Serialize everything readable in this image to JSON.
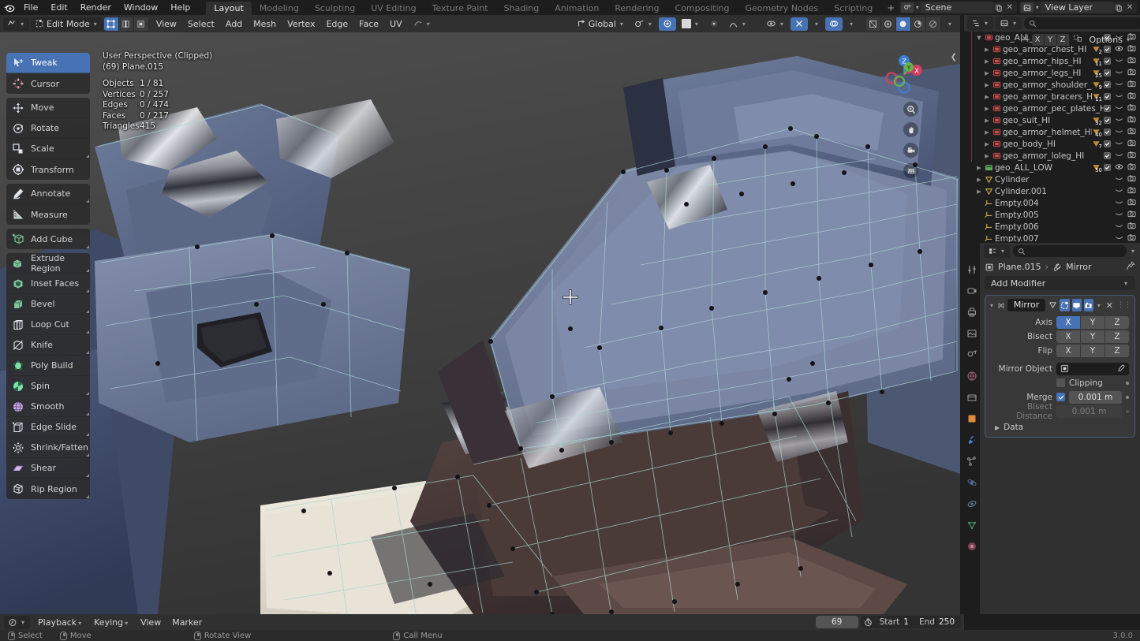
{
  "topbar": {
    "menus": [
      "File",
      "Edit",
      "Render",
      "Window",
      "Help"
    ],
    "workspaces": [
      {
        "label": "Layout",
        "active": true
      },
      {
        "label": "Modeling",
        "active": false
      },
      {
        "label": "Sculpting",
        "active": false
      },
      {
        "label": "UV Editing",
        "active": false
      },
      {
        "label": "Texture Paint",
        "active": false
      },
      {
        "label": "Shading",
        "active": false
      },
      {
        "label": "Animation",
        "active": false
      },
      {
        "label": "Rendering",
        "active": false
      },
      {
        "label": "Compositing",
        "active": false
      },
      {
        "label": "Geometry Nodes",
        "active": false
      },
      {
        "label": "Scripting",
        "active": false
      }
    ],
    "add_workspace": "+",
    "scene_name": "Scene",
    "view_layer_name": "View Layer"
  },
  "viewport_header": {
    "mode": "Edit Mode",
    "menus": [
      "View",
      "Select",
      "Add",
      "Mesh",
      "Vertex",
      "Edge",
      "Face",
      "UV"
    ],
    "transform_orientation": "Global",
    "select_modes": [
      "vertex-select",
      "edge-select",
      "face-select"
    ],
    "options_label": "Options",
    "mirror_axes": [
      "X",
      "Y",
      "Z"
    ]
  },
  "toolbar": {
    "groups": [
      [
        {
          "label": "Tweak",
          "icon": "tweak-icon",
          "active": true,
          "tip": false
        },
        {
          "label": "Cursor",
          "icon": "cursor-icon",
          "active": false,
          "tip": false
        }
      ],
      [
        {
          "label": "Move",
          "icon": "move-icon",
          "active": false,
          "tip": false
        },
        {
          "label": "Rotate",
          "icon": "rotate-icon",
          "active": false,
          "tip": false
        },
        {
          "label": "Scale",
          "icon": "scale-icon",
          "active": false,
          "tip": true
        },
        {
          "label": "Transform",
          "icon": "transform-icon",
          "active": false,
          "tip": false
        }
      ],
      [
        {
          "label": "Annotate",
          "icon": "annotate-icon",
          "active": false,
          "tip": true
        },
        {
          "label": "Measure",
          "icon": "measure-icon",
          "active": false,
          "tip": false
        }
      ],
      [
        {
          "label": "Add Cube",
          "icon": "add-cube-icon",
          "active": false,
          "tip": true
        }
      ],
      [
        {
          "label": "Extrude Region",
          "icon": "extrude-icon",
          "active": false,
          "tip": true
        },
        {
          "label": "Inset Faces",
          "icon": "inset-faces-icon",
          "active": false,
          "tip": true
        },
        {
          "label": "Bevel",
          "icon": "bevel-icon",
          "active": false,
          "tip": true
        },
        {
          "label": "Loop Cut",
          "icon": "loop-cut-icon",
          "active": false,
          "tip": true
        },
        {
          "label": "Knife",
          "icon": "knife-icon",
          "active": false,
          "tip": true
        },
        {
          "label": "Poly Build",
          "icon": "poly-build-icon",
          "active": false,
          "tip": false
        },
        {
          "label": "Spin",
          "icon": "spin-icon",
          "active": false,
          "tip": true
        },
        {
          "label": "Smooth",
          "icon": "smooth-icon",
          "active": false,
          "tip": true
        },
        {
          "label": "Edge Slide",
          "icon": "edge-slide-icon",
          "active": false,
          "tip": true
        },
        {
          "label": "Shrink/Fatten",
          "icon": "shrink-fatten-icon",
          "active": false,
          "tip": true
        },
        {
          "label": "Shear",
          "icon": "shear-icon",
          "active": false,
          "tip": true
        },
        {
          "label": "Rip Region",
          "icon": "rip-region-icon",
          "active": false,
          "tip": true
        }
      ]
    ]
  },
  "viewport_overlay": {
    "perspective": "User Perspective (Clipped)",
    "active_object": "(69) Plane.015",
    "stats": [
      {
        "key": "Objects",
        "value": "1 / 81"
      },
      {
        "key": "Vertices",
        "value": "0 / 257"
      },
      {
        "key": "Edges",
        "value": "0 / 474"
      },
      {
        "key": "Faces",
        "value": "0 / 217"
      },
      {
        "key": "Triangles",
        "value": "415"
      }
    ],
    "gizmo_axes": [
      "Z",
      "Y",
      "X"
    ],
    "nav_buttons": [
      "zoom-icon",
      "pan-hand-icon",
      "camera-icon",
      "grid-icon"
    ]
  },
  "outliner": {
    "search_placeholder": "",
    "rows": [
      {
        "label": "geo_ALL_HI",
        "icon": "mesh-data-icon",
        "indent": 1,
        "disclosure": "down",
        "selected": false,
        "eye": false,
        "check": true,
        "camera": true,
        "badge": "",
        "color": "#c14f4f"
      },
      {
        "label": "geo_armor_chest_HI",
        "icon": "mesh-data-icon",
        "indent": 2,
        "disclosure": "right",
        "selected": false,
        "eye": true,
        "check": true,
        "camera": true,
        "badge": "2",
        "color": "#c14f4f"
      },
      {
        "label": "geo_armor_hips_HI",
        "icon": "mesh-data-icon",
        "indent": 2,
        "disclosure": "right",
        "selected": false,
        "eye": false,
        "check": true,
        "camera": true,
        "badge": "11",
        "color": "#c14f4f"
      },
      {
        "label": "geo_armor_legs_HI",
        "icon": "mesh-data-icon",
        "indent": 2,
        "disclosure": "right",
        "selected": false,
        "eye": false,
        "check": true,
        "camera": true,
        "badge": "25",
        "color": "#c14f4f"
      },
      {
        "label": "geo_armor_shoulder_HI",
        "icon": "mesh-data-icon",
        "indent": 2,
        "disclosure": "right",
        "selected": false,
        "eye": false,
        "check": true,
        "camera": true,
        "badge": "9",
        "color": "#c14f4f"
      },
      {
        "label": "geo_armor_bracers_HI",
        "icon": "mesh-data-icon",
        "indent": 2,
        "disclosure": "right",
        "selected": false,
        "eye": false,
        "check": true,
        "camera": true,
        "badge": "11",
        "color": "#c14f4f"
      },
      {
        "label": "geo_armor_pec_plates_HI",
        "icon": "mesh-data-icon",
        "indent": 2,
        "disclosure": "right",
        "selected": false,
        "eye": false,
        "check": true,
        "camera": true,
        "badge": "",
        "color": "#c14f4f"
      },
      {
        "label": "geo_suit_HI",
        "icon": "mesh-data-icon",
        "indent": 2,
        "disclosure": "right",
        "selected": false,
        "eye": false,
        "check": true,
        "camera": true,
        "badge": "32",
        "color": "#c14f4f"
      },
      {
        "label": "geo_armor_helmet_HI",
        "icon": "mesh-data-icon",
        "indent": 2,
        "disclosure": "right",
        "selected": false,
        "eye": false,
        "check": true,
        "camera": true,
        "badge": "40",
        "color": "#c14f4f"
      },
      {
        "label": "geo_body_HI",
        "icon": "mesh-data-icon",
        "indent": 2,
        "disclosure": "right",
        "selected": false,
        "eye": false,
        "check": true,
        "camera": true,
        "badge": "7",
        "color": "#c14f4f"
      },
      {
        "label": "geo_armor_loleg_HI",
        "icon": "mesh-data-icon",
        "indent": 2,
        "disclosure": "right",
        "selected": false,
        "eye": false,
        "check": true,
        "camera": true,
        "badge": "",
        "color": "#c14f4f"
      },
      {
        "label": "geo_ALL_LOW",
        "icon": "collection-icon",
        "indent": 1,
        "disclosure": "right",
        "selected": false,
        "eye": true,
        "check": true,
        "camera": true,
        "badge": "50",
        "color": "#5ea85e"
      },
      {
        "label": "Cylinder",
        "icon": "empty-mesh-icon",
        "indent": 1,
        "disclosure": "right",
        "selected": false,
        "eye": false,
        "check": false,
        "camera": true,
        "badge": "",
        "color": "#c8a24a"
      },
      {
        "label": "Cylinder.001",
        "icon": "empty-mesh-icon",
        "indent": 1,
        "disclosure": "right",
        "selected": false,
        "eye": false,
        "check": false,
        "camera": true,
        "badge": "",
        "color": "#c8a24a"
      },
      {
        "label": "Empty.004",
        "icon": "empty-axes-icon",
        "indent": 1,
        "disclosure": "none",
        "selected": false,
        "eye": false,
        "check": false,
        "camera": true,
        "badge": "",
        "color": "#c8a24a"
      },
      {
        "label": "Empty.005",
        "icon": "empty-axes-icon",
        "indent": 1,
        "disclosure": "none",
        "selected": false,
        "eye": false,
        "check": false,
        "camera": true,
        "badge": "",
        "color": "#c8a24a"
      },
      {
        "label": "Empty.006",
        "icon": "empty-axes-icon",
        "indent": 1,
        "disclosure": "none",
        "selected": false,
        "eye": false,
        "check": false,
        "camera": true,
        "badge": "",
        "color": "#c8a24a"
      },
      {
        "label": "Empty.007",
        "icon": "empty-axes-icon",
        "indent": 1,
        "disclosure": "none",
        "selected": false,
        "eye": false,
        "check": false,
        "camera": true,
        "badge": "",
        "color": "#c8a24a"
      }
    ]
  },
  "properties": {
    "breadcrumb_object": "Plane.015",
    "breadcrumb_modifier": "Mirror",
    "add_modifier_label": "Add Modifier",
    "modifier": {
      "name": "Mirror",
      "axis_label": "Axis",
      "axis_options": [
        "X",
        "Y",
        "Z"
      ],
      "axis_active": [
        "X"
      ],
      "bisect_label": "Bisect",
      "bisect_options": [
        "X",
        "Y",
        "Z"
      ],
      "bisect_active": [],
      "flip_label": "Flip",
      "flip_options": [
        "X",
        "Y",
        "Z"
      ],
      "flip_active": [],
      "mirror_object_label": "Mirror Object",
      "mirror_object_value": "",
      "clipping_label": "Clipping",
      "clipping_checked": false,
      "merge_label": "Merge",
      "merge_checked": true,
      "merge_value": "0.001 m",
      "bisect_distance_label": "Bisect Distance",
      "bisect_distance_value": "0.001 m",
      "data_label": "Data"
    }
  },
  "timeline": {
    "menus": [
      "Playback",
      "Keying",
      "View",
      "Marker"
    ],
    "current_frame": "69",
    "start_label": "Start",
    "start_value": "1",
    "end_label": "End",
    "end_value": "250"
  },
  "statusbar": {
    "items": [
      {
        "icon": "mouse-left-icon",
        "label": "Select"
      },
      {
        "icon": "mouse-move-icon",
        "label": "Move"
      },
      {
        "icon": "mouse-middle-icon",
        "label": "Rotate View"
      },
      {
        "icon": "mouse-right-icon",
        "label": "Call Menu"
      }
    ],
    "version": "3.0.0"
  },
  "colors": {
    "accent": "#4772b3",
    "header": "#303030",
    "panel": "#1d1d1d",
    "viewport_bg": "#3c3c3c",
    "armor_blue": "#6b7a99",
    "armor_dark": "#4a3a38",
    "edge_cyan": "#9fd3cf"
  }
}
